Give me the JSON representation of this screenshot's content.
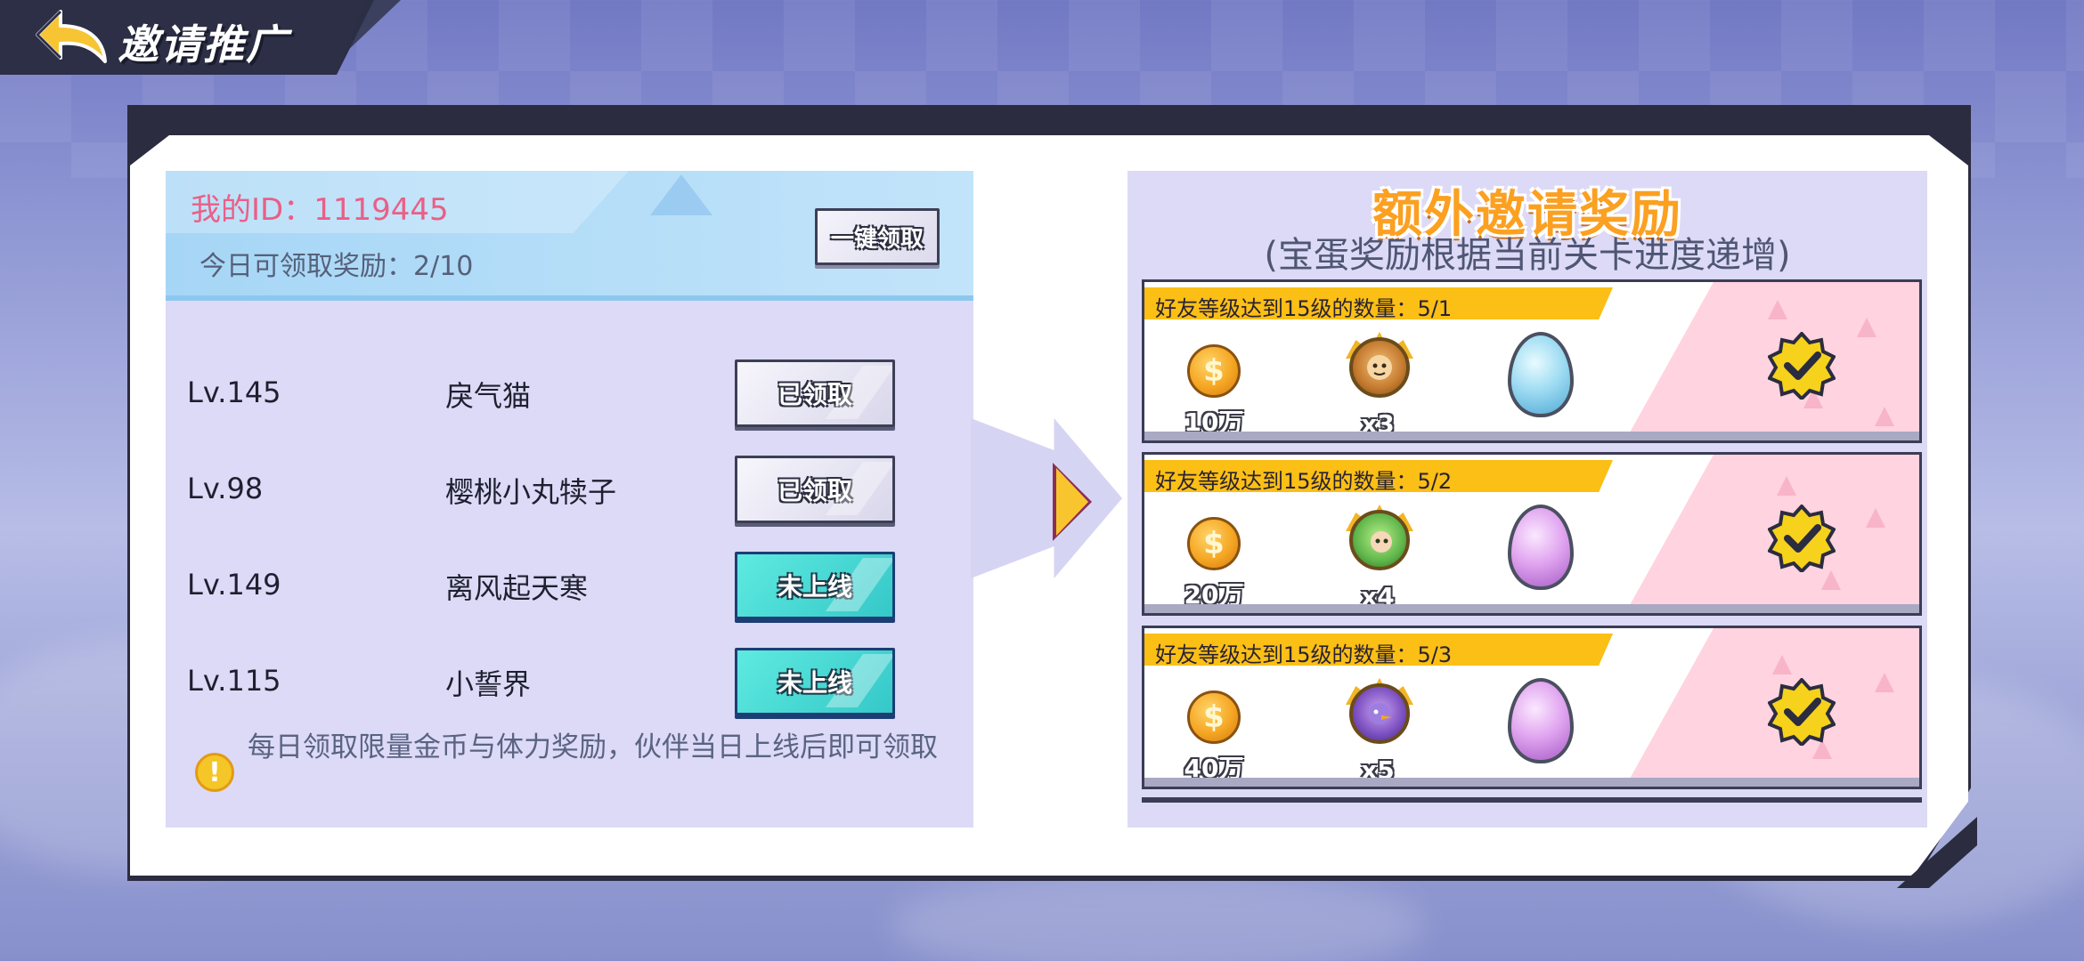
{
  "header": {
    "title": "邀请推广"
  },
  "invite": {
    "my_id": "我的ID：1119445",
    "today_claim": "今日可领取奖励：2/10",
    "claim_all_label": "一键领取"
  },
  "friends": [
    {
      "level": "Lv.145",
      "name": "戾气猫",
      "status": "已领取",
      "claimed": true
    },
    {
      "level": "Lv.98",
      "name": "樱桃小丸犊子",
      "status": "已领取",
      "claimed": true
    },
    {
      "level": "Lv.149",
      "name": "离风起天寒",
      "status": "未上线",
      "claimed": false
    },
    {
      "level": "Lv.115",
      "name": "小誓界",
      "status": "未上线",
      "claimed": false
    }
  ],
  "notice": "每日领取限量金币与体力奖励，伙伴当日上线后即可领取",
  "bonus": {
    "title": "额外邀请奖励",
    "subtitle": "(宝蛋奖励根据当前关卡进度递增)",
    "rewards": [
      {
        "condition": "好友等级达到15级的数量：5/1",
        "coins": "10万",
        "hero_count": "x3",
        "egg": "blue-egg-icon",
        "completed": true
      },
      {
        "condition": "好友等级达到15级的数量：5/2",
        "coins": "20万",
        "hero_count": "x4",
        "egg": "purple-egg-icon",
        "completed": true
      },
      {
        "condition": "好友等级达到15级的数量：5/3",
        "coins": "40万",
        "hero_count": "x5",
        "egg": "purple-egg-icon",
        "completed": true
      }
    ]
  },
  "colors": {
    "panel_dark": "#2b2c40",
    "section_bg": "#dcdaf6",
    "id_pink": "#ea5f86",
    "title_orange": "#fba021",
    "banner_yellow": "#fbbf15",
    "offline_cyan": "#35c8c8",
    "check_yellow": "#f6d21c"
  }
}
